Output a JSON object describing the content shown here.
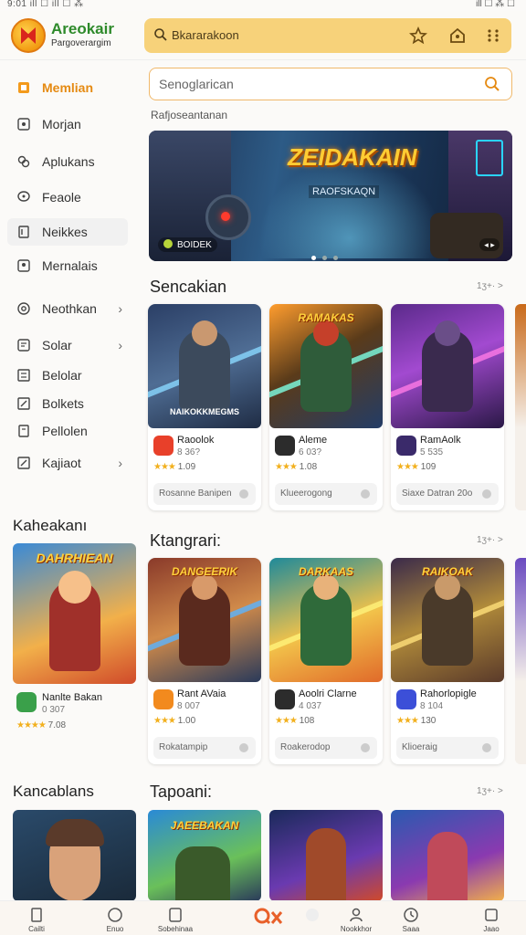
{
  "status_bar": {
    "left": "9:01 ill ☐ ill ☐ ⁂",
    "right": "ill ☐ ⁂ ☐"
  },
  "header": {
    "app_name": "Areokair",
    "app_subtitle": "Pargoverargim",
    "search_text": "Bkararakoon",
    "icons": [
      "star-icon",
      "home-icon",
      "grid-icon"
    ]
  },
  "sidebar": {
    "items": [
      {
        "label": "Memlian",
        "icon": "home-icon",
        "active": true,
        "chevron": false
      },
      {
        "label": "Morjan",
        "icon": "square-icon",
        "active": false,
        "chevron": false
      },
      {
        "label": "Aplukans",
        "icon": "link-icon",
        "active": false,
        "chevron": false
      },
      {
        "label": "Feaole",
        "icon": "chat-icon",
        "active": false,
        "chevron": false
      },
      {
        "label": "Neikkes",
        "icon": "note-icon",
        "active": false,
        "chevron": false,
        "highlight": true
      },
      {
        "label": "Mernalais",
        "icon": "pin-icon",
        "active": false,
        "chevron": false
      },
      {
        "label": "Neothkan",
        "icon": "at-icon",
        "active": false,
        "chevron": true
      },
      {
        "label": "Solar",
        "icon": "doc-icon",
        "active": false,
        "chevron": true
      },
      {
        "label": "Belolar",
        "icon": "list-icon",
        "active": false,
        "chevron": false
      },
      {
        "label": "Bolkets",
        "icon": "edit-icon",
        "active": false,
        "chevron": false
      },
      {
        "label": "Pellolen",
        "icon": "file-icon",
        "active": false,
        "chevron": false
      },
      {
        "label": "Kajiaot",
        "icon": "edit-icon",
        "active": false,
        "chevron": true
      }
    ]
  },
  "main": {
    "search_placeholder": "Senoglarican",
    "subline": "Rafjoseantanan",
    "banner": {
      "title": "ZEIDAKAIN",
      "subtitle": "RAOFSKAQN",
      "badge": "BOIDEK",
      "more": "◂ ▸"
    },
    "sections": [
      {
        "title": "Sencakian",
        "more": "1ʒ+· >",
        "cards": [
          {
            "name": "Raoolok",
            "sub": "8 36?",
            "rating": "1.09",
            "stars": "★★★",
            "button": "Rosanne Banipen",
            "caption": "",
            "label": "NAIKOKKMEGMS",
            "icon_color": "#e8402a"
          },
          {
            "name": "Aleme",
            "sub": "6 03?",
            "rating": "1.08",
            "stars": "★★★",
            "button": "Klueerogong",
            "caption": "RAMAKAS",
            "label": "",
            "icon_color": "#2c2c2c"
          },
          {
            "name": "RamAolk",
            "sub": "5 535",
            "rating": "109",
            "stars": "★★★",
            "button": "Siaxe Datran 20o",
            "caption": "",
            "label": "",
            "icon_color": "#3a2a6a"
          }
        ]
      },
      {
        "title": "Ktangrari:",
        "more": "1ʒ+· >",
        "cards": [
          {
            "name": "Rant AVaia",
            "sub": "8 007",
            "rating": "1.00",
            "stars": "★★★",
            "button": "Rokatampip",
            "caption": "DANGEERIK",
            "label": "",
            "icon_color": "#f28a1e"
          },
          {
            "name": "Aoolri Clarne",
            "sub": "4 037",
            "rating": "108",
            "stars": "★★★",
            "button": "Roakerodop",
            "caption": "DARKAAS",
            "label": "",
            "icon_color": "#2c2c2c"
          },
          {
            "name": "Rahorlopigle",
            "sub": "8 104",
            "rating": "130",
            "stars": "★★★",
            "button": "Klioeraig",
            "caption": "RAIKOAK",
            "label": "",
            "icon_color": "#3c4fd8"
          }
        ]
      },
      {
        "title": "Tapoani:",
        "more": "1ʒ+· >",
        "cards": [
          {
            "caption": "JAEEBAKAN"
          },
          {
            "caption": ""
          },
          {
            "caption": ""
          }
        ]
      }
    ]
  },
  "left_sections": [
    {
      "title": "Kaheakanı",
      "card": {
        "name": "Nanlte Bakan",
        "sub": "0 307",
        "rating": "7.08",
        "stars": "★★★★",
        "caption": "DAHRHIEAN"
      }
    },
    {
      "title": "Kancablans"
    }
  ],
  "bottom_nav": [
    {
      "label": "Cailti",
      "icon": "bookmark-icon"
    },
    {
      "label": "Enuo",
      "icon": "circle-icon"
    },
    {
      "label": "Sobehinaa",
      "icon": "square-icon"
    },
    {
      "label": "",
      "icon": "qx-icon",
      "center": true
    },
    {
      "label": "",
      "icon": "moon-icon"
    },
    {
      "label": "Nookkhor",
      "icon": "user-icon"
    },
    {
      "label": "Saaa",
      "icon": "clock-icon"
    },
    {
      "label": "Jaao",
      "icon": "tab-icon"
    }
  ],
  "colors": {
    "accent": "#e58a12",
    "search_bg": "#f7d27a",
    "brand_green": "#2e8a2a"
  }
}
